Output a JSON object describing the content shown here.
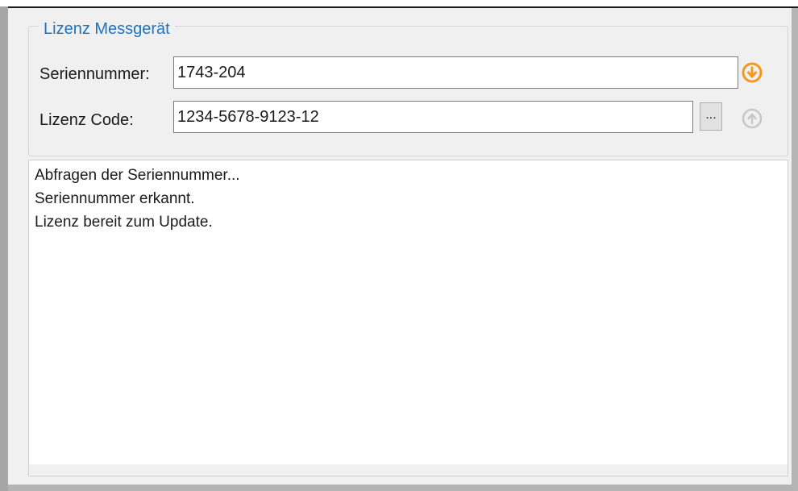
{
  "group": {
    "title": "Lizenz Messgerät"
  },
  "serial": {
    "label": "Seriennummer:",
    "value": "1743-204"
  },
  "license": {
    "label": "Lizenz Code:",
    "value": "1234-5678-9123-12",
    "browse_label": "..."
  },
  "icons": {
    "download": "download-circle-icon",
    "upload": "upload-circle-icon",
    "accent_color": "#f29a1e",
    "disabled_color": "#c8c8c8"
  },
  "log": {
    "lines": [
      "Abfragen der Seriennummer...",
      "Seriennummer erkannt.",
      "Lizenz bereit zum Update."
    ]
  }
}
